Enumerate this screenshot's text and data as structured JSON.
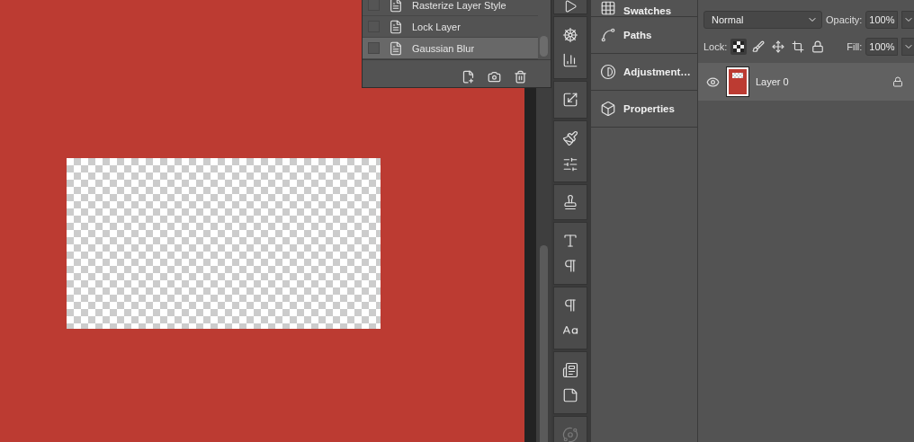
{
  "history_panel": {
    "items": [
      {
        "label": "Rasterize Layer Style",
        "selected": false
      },
      {
        "label": "Lock Layer",
        "selected": false
      },
      {
        "label": "Gaussian Blur",
        "selected": true
      }
    ]
  },
  "panel_tabs": [
    {
      "label": "Swatches",
      "kind": "swatches"
    },
    {
      "label": "Paths",
      "kind": "paths"
    },
    {
      "label": "Adjustment…",
      "kind": "adjustments"
    },
    {
      "label": "Properties",
      "kind": "properties"
    }
  ],
  "layers_panel": {
    "blend_mode": "Normal",
    "opacity_label": "Opacity:",
    "opacity": "100%",
    "lock_label": "Lock:",
    "fill_label": "Fill:",
    "fill": "100%",
    "layers": [
      {
        "name": "Layer 0",
        "visible": true,
        "locked": true,
        "selected": true
      }
    ]
  }
}
